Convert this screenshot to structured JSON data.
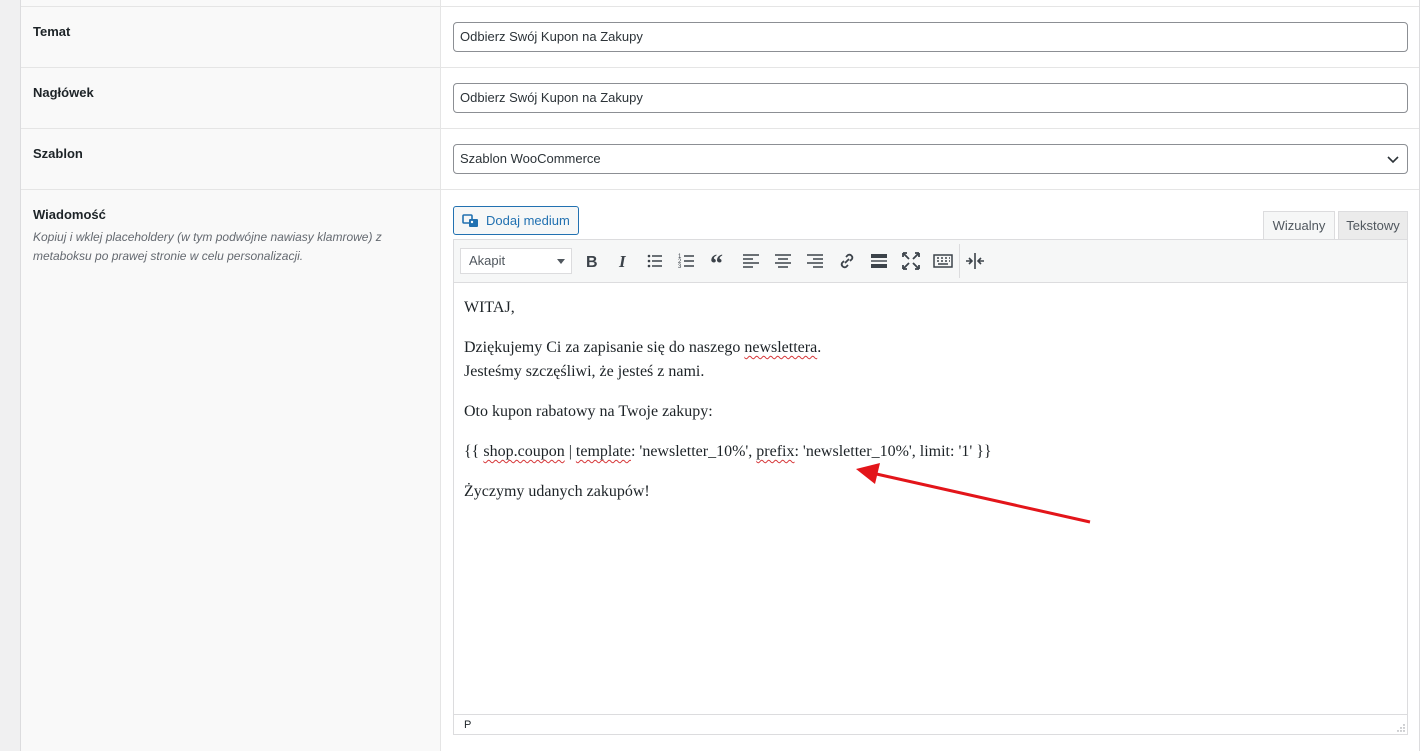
{
  "fields": {
    "subject": {
      "label": "Temat",
      "value": "Odbierz Swój Kupon na Zakupy"
    },
    "heading": {
      "label": "Nagłówek",
      "value": "Odbierz Swój Kupon na Zakupy"
    },
    "template": {
      "label": "Szablon",
      "value": "Szablon WooCommerce"
    },
    "message": {
      "label": "Wiadomość",
      "description": "Kopiuj i wklej placeholdery (w tym podwójne nawiasy klamrowe) z metaboksu po prawej stronie w celu personalizacji."
    }
  },
  "editor": {
    "add_media_label": "Dodaj medium",
    "tabs": {
      "visual": "Wizualny",
      "text": "Tekstowy"
    },
    "format_select": "Akapit",
    "status_path": "P",
    "content": {
      "line1": "WITAJ,",
      "line2a_pre": "Dziękujemy Ci za zapisanie się do naszego ",
      "line2a_word": "newslettera",
      "line2a_post": ".",
      "line2b": "Jesteśmy szczęśliwi, że jesteś z nami.",
      "line3": "Oto kupon rabatowy na Twoje zakupy:",
      "coupon_open": "{{ ",
      "coupon_shop": "shop.coupon",
      "coupon_pipe": " | ",
      "coupon_template": "template",
      "coupon_mid": ": 'newsletter_10%', ",
      "coupon_prefix": "prefix",
      "coupon_end": ": 'newsletter_10%', limit: '1' }}",
      "line5": "Życzymy udanych zakupów!"
    },
    "toolbar_icons": [
      "bold-icon",
      "italic-icon",
      "bullet-list-icon",
      "numbered-list-icon",
      "blockquote-icon",
      "align-left-icon",
      "align-center-icon",
      "align-right-icon",
      "link-icon",
      "read-more-icon",
      "fullscreen-icon",
      "toolbar-toggle-icon",
      "page-break-icon"
    ]
  },
  "colors": {
    "accent": "#2271b1",
    "annotation_arrow": "#e3151a",
    "spellcheck": "#d63638"
  }
}
